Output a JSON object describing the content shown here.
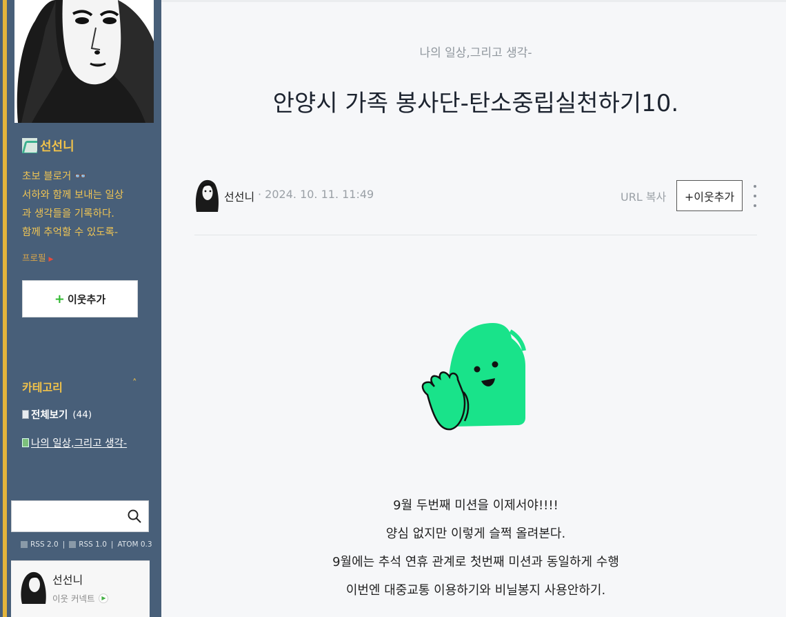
{
  "sidebar": {
    "owner_name": "선선니",
    "bio": [
      "초보 블로거 👓",
      "서하와 함께 보내는 일상",
      "과 생각들을 기록하다.",
      "함께 추억할 수 있도록-"
    ],
    "profile_link": "프로필",
    "neighbor_button": "이웃추가",
    "category_title": "카테고리",
    "category_toggle": "˄",
    "categories": [
      {
        "label": "전체보기",
        "count": "(44)"
      },
      {
        "label": "나의 일상,그리고 생각-"
      }
    ],
    "search": {
      "placeholder": ""
    },
    "rss": [
      "RSS 2.0",
      "RSS 1.0",
      "ATOM 0.3"
    ],
    "widget": {
      "name": "선선니",
      "sub": "이웃 커넥트"
    }
  },
  "post": {
    "category": "나의 일상,그리고 생각-",
    "title": "안양시 가족 봉사단-탄소중립실천하기10.",
    "author": "선선니",
    "date": "· 2024. 10. 11. 11:49",
    "url_copy": "URL 복사",
    "follow_button": "+이웃추가",
    "body_lines": [
      "9월 두번째 미션을 이제서야!!!!",
      "양심 없지만 이렇게 슬쩍 올려본다.",
      "9월에는 추석 연휴 관계로 첫번째 미션과 동일하게 수행",
      "이번엔 대중교통 이용하기와 비닐봉지 사용안하기."
    ]
  },
  "colors": {
    "sidebar_bg": "#485f79",
    "accent_yellow": "#f2c34a",
    "sticker_green": "#19e38a"
  }
}
